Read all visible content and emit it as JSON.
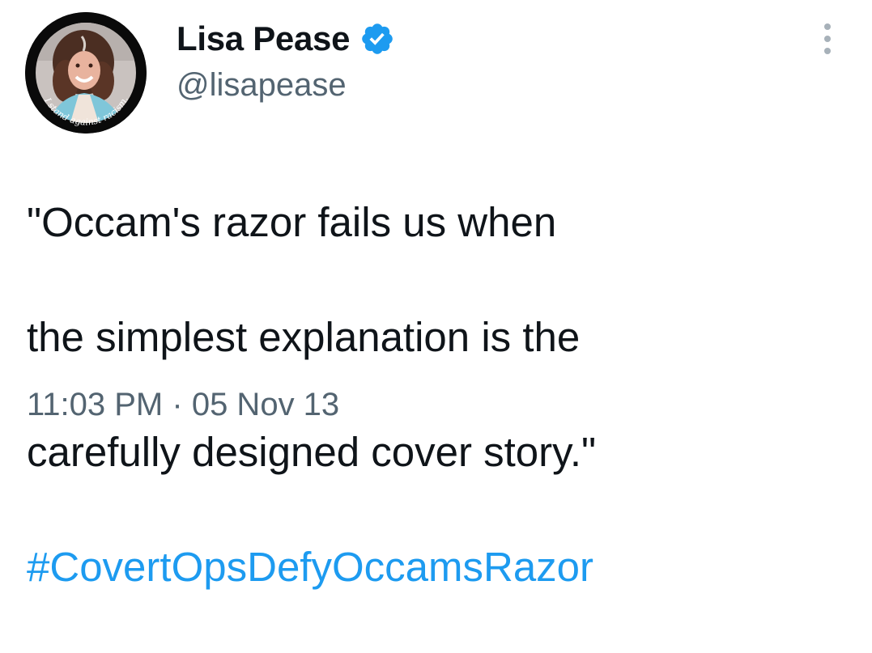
{
  "author": {
    "display_name": "Lisa Pease",
    "handle": "@lisapease",
    "verified": true,
    "avatar_caption": "I stand against racism."
  },
  "tweet": {
    "text_lines": [
      "\"Occam's razor fails us when",
      "the simplest explanation is the",
      "carefully designed cover story.\""
    ],
    "hashtag": "#CovertOpsDefyOccamsRazor"
  },
  "meta": {
    "time": "11:03 PM",
    "separator": "·",
    "date": "05 Nov 13"
  },
  "icons": {
    "verified": "verified-badge-icon",
    "more": "more-dots-icon"
  },
  "colors": {
    "link": "#1d9bf0",
    "secondary_text": "#536471",
    "primary_text": "#0f1419",
    "verified": "#1d9bf0"
  }
}
